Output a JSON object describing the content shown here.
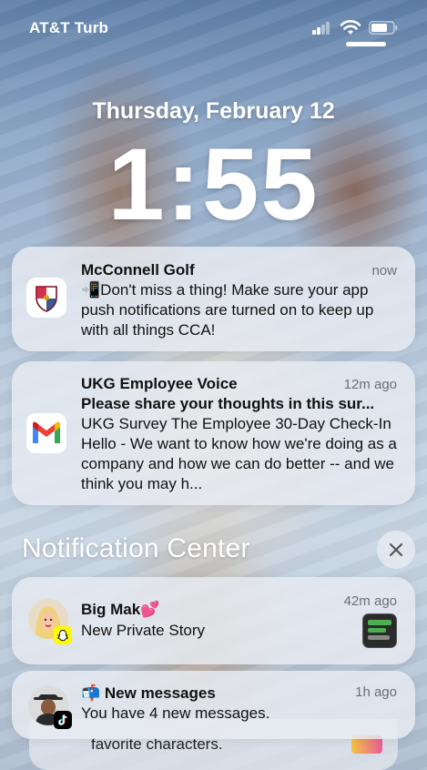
{
  "status_bar": {
    "carrier": "AT&T Turb",
    "colors": {
      "icons": "#ffffff"
    }
  },
  "lock_screen": {
    "date": "Thursday, February 12",
    "time": "1:55"
  },
  "notifications": [
    {
      "app": "McConnell Golf",
      "icon": "golf-crest-icon",
      "time": "now",
      "body": "📲Don't miss a thing! Make sure your app push notifications are turned on to keep up with all things CCA!"
    },
    {
      "app": "UKG Employee Voice",
      "icon": "gmail-icon",
      "time": "12m ago",
      "subject": "Please share your thoughts in this sur...",
      "body": "UKG Survey The Employee 30-Day Check-In Hello - We want to know how we're doing as a company and how we can do better -- and we think you may h..."
    }
  ],
  "notification_center": {
    "title": "Notification Center",
    "close_icon": "close-icon",
    "items": [
      {
        "sender": "Big Mak💕",
        "app_badge": "snapchat-icon",
        "time": "42m ago",
        "body": "New Private Story"
      },
      {
        "sender": "📬 New messages",
        "app_badge": "tiktok-icon",
        "time": "1h ago",
        "body": "You have 4 new messages."
      }
    ],
    "stacked_preview": "favorite characters."
  },
  "colors": {
    "card_background": "#e8ecf2",
    "secondary_text": "#6a6f78",
    "gmail_red": "#ea4335",
    "gmail_blue": "#4285f4",
    "gmail_green": "#34a853",
    "gmail_yellow": "#fbbc04",
    "snapchat_yellow": "#fffc00"
  }
}
